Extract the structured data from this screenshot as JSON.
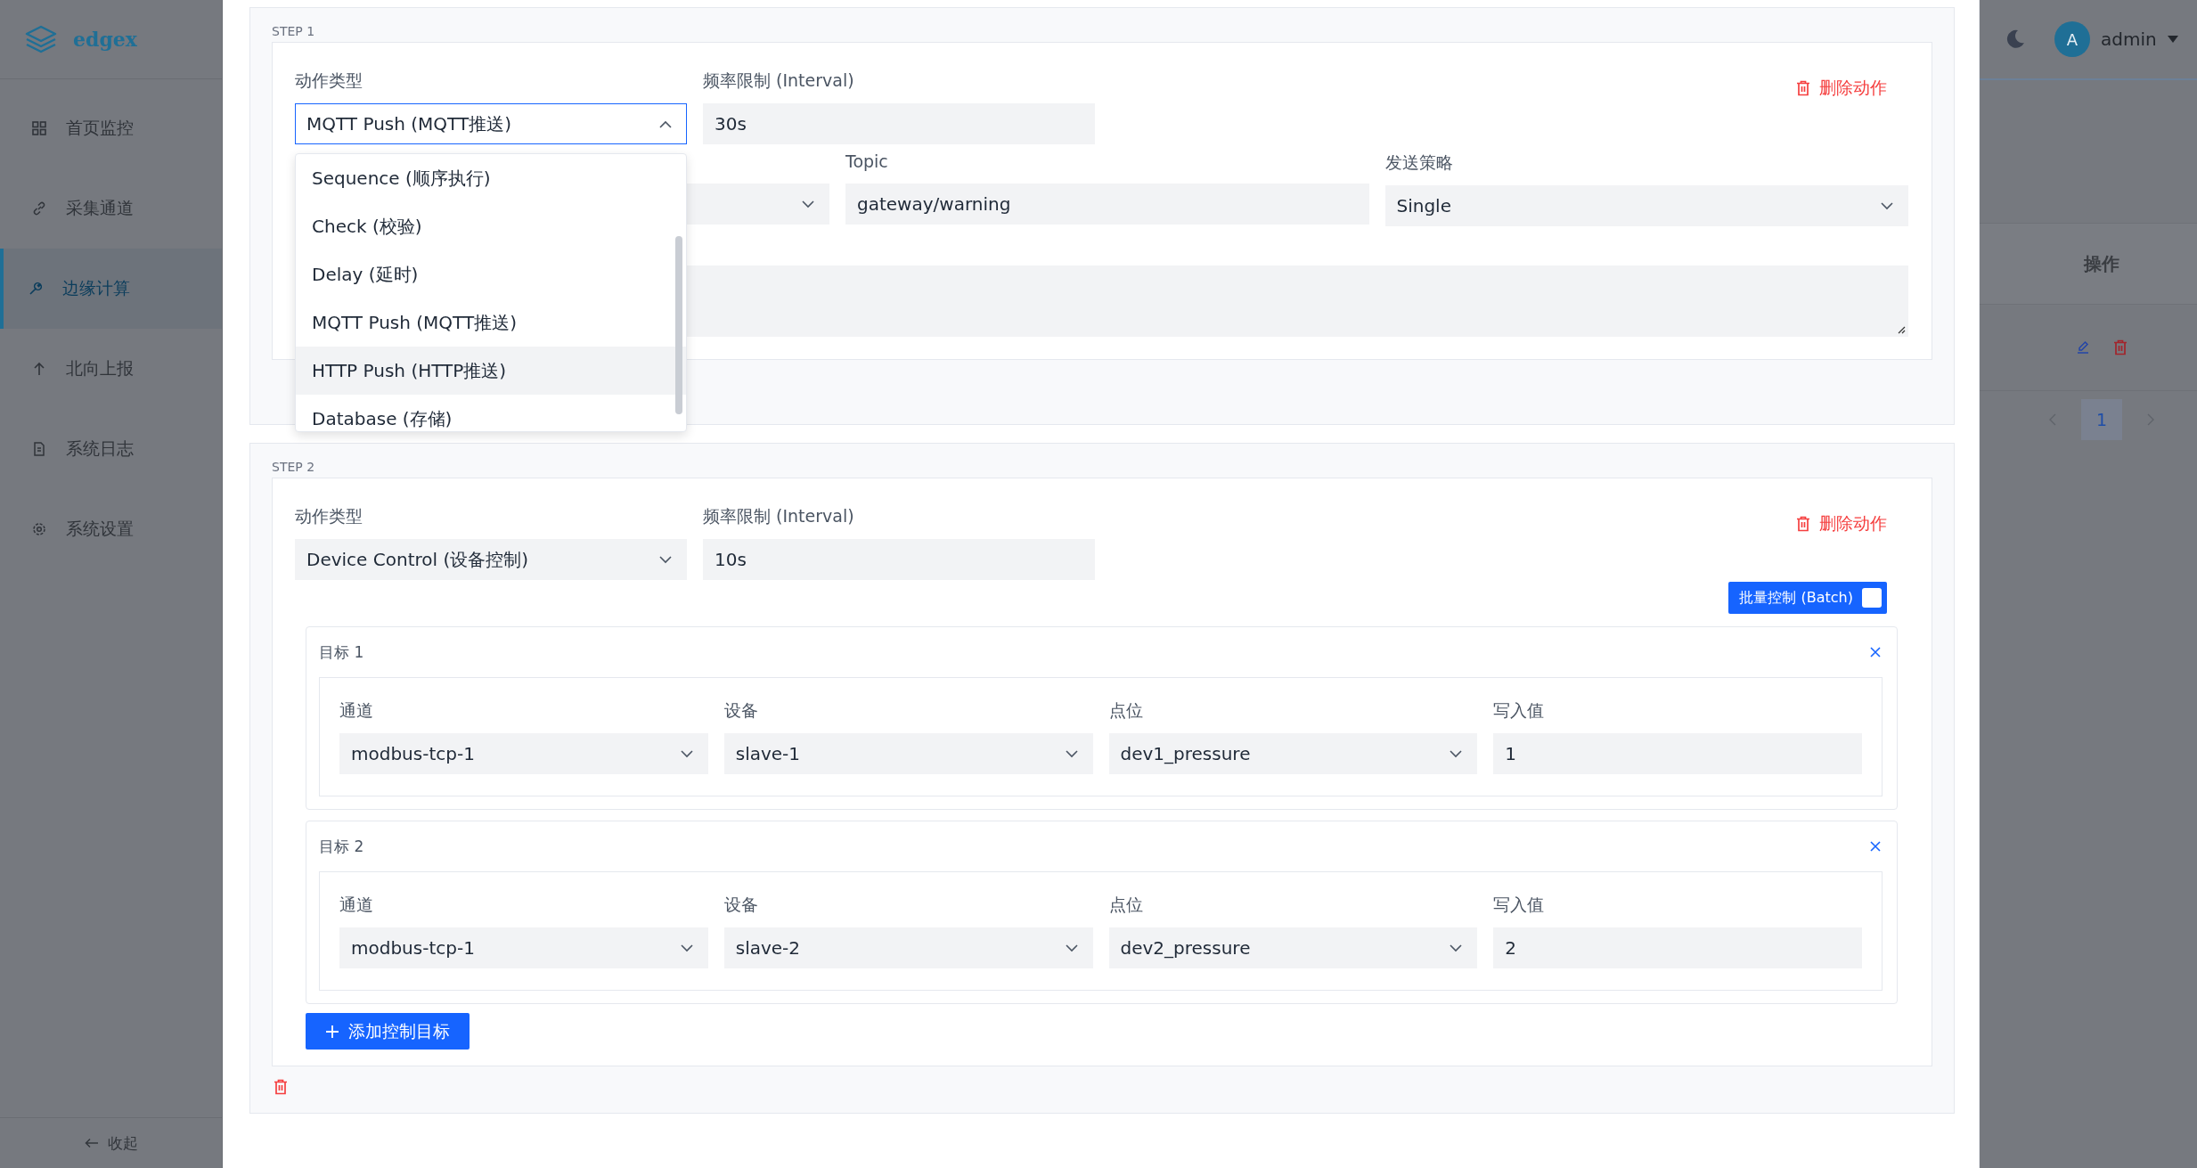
{
  "sidebar": {
    "brand": "edgex",
    "items": [
      {
        "label": "首页监控",
        "selected": false
      },
      {
        "label": "采集通道",
        "selected": false
      },
      {
        "label": "边缘计算",
        "selected": true
      },
      {
        "label": "北向上报",
        "selected": false
      },
      {
        "label": "系统日志",
        "selected": false
      },
      {
        "label": "系统设置",
        "selected": false
      }
    ],
    "collapse": "收起"
  },
  "header": {
    "avatar": "A",
    "user": "admin"
  },
  "background_table": {
    "column": "操作",
    "pages": [
      {
        "label": "1",
        "selected": true
      }
    ]
  },
  "steps": [
    {
      "label": "STEP 1",
      "kind": "mqtt",
      "type_label": "动作类型",
      "type_value": "MQTT Push (MQTT推送)",
      "dropdown_open": true,
      "interval_label": "频率限制 (Interval)",
      "interval_value": "30s",
      "delete_action": "删除动作",
      "fields": [
        {
          "kind": "select"
        },
        {
          "kind": "input",
          "label": "Topic",
          "value": "gateway/warning"
        },
        {
          "kind": "select",
          "label": "发送策略",
          "value": "Single"
        }
      ],
      "options": [
        {
          "label": "Sequence (顺序执行)",
          "highlighted": false
        },
        {
          "label": "Check (校验)",
          "highlighted": false
        },
        {
          "label": "Delay (延时)",
          "highlighted": false
        },
        {
          "label": "MQTT Push (MQTT推送)",
          "highlighted": false
        },
        {
          "label": "HTTP Push (HTTP推送)",
          "highlighted": true
        },
        {
          "label": "Database (存储)",
          "highlighted": false
        }
      ]
    },
    {
      "label": "STEP 2",
      "kind": "device_control",
      "type_label": "动作类型",
      "type_value": "Device Control (设备控制)",
      "dropdown_open": false,
      "interval_label": "频率限制 (Interval)",
      "interval_value": "10s",
      "delete_action": "删除动作",
      "batch": {
        "label": "批量控制 (Batch)",
        "checked": false
      },
      "targets": [
        {
          "title": "目标 1",
          "fields": [
            {
              "kind": "select",
              "label": "通道",
              "value": "modbus-tcp-1"
            },
            {
              "kind": "select",
              "label": "设备",
              "value": "slave-1"
            },
            {
              "kind": "select",
              "label": "点位",
              "value": "dev1_pressure"
            },
            {
              "kind": "input",
              "label": "写入值",
              "value": "1"
            }
          ]
        },
        {
          "title": "目标 2",
          "fields": [
            {
              "kind": "select",
              "label": "通道",
              "value": "modbus-tcp-1"
            },
            {
              "kind": "select",
              "label": "设备",
              "value": "slave-2"
            },
            {
              "kind": "select",
              "label": "点位",
              "value": "dev2_pressure"
            },
            {
              "kind": "input",
              "label": "写入值",
              "value": "2"
            }
          ]
        }
      ],
      "add_target": "添加控制目标"
    }
  ]
}
